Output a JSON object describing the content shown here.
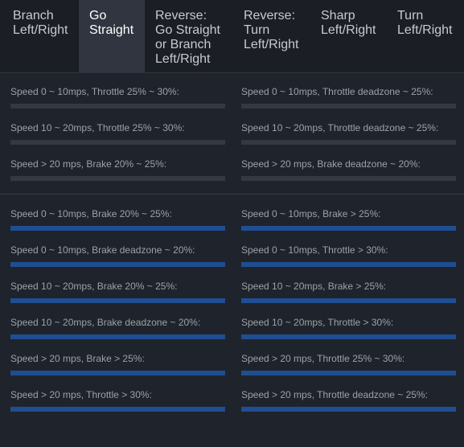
{
  "tabs": [
    {
      "lines": [
        "Branch",
        "Left/Right"
      ],
      "active": false
    },
    {
      "lines": [
        "Go",
        "Straight"
      ],
      "active": true
    },
    {
      "lines": [
        "Reverse:",
        "Go Straight",
        "or Branch",
        "Left/Right"
      ],
      "active": false
    },
    {
      "lines": [
        "Reverse:",
        "Turn",
        "Left/Right"
      ],
      "active": false
    },
    {
      "lines": [
        "Sharp",
        "Left/Right"
      ],
      "active": false
    },
    {
      "lines": [
        "Turn",
        "Left/Right"
      ],
      "active": false
    }
  ],
  "colors": {
    "background": "#1f232b",
    "bar_track": "#34383f",
    "bar_fill": "#1f4e93",
    "active_tab": "#30353f"
  },
  "section1": {
    "left": [
      {
        "label": "Speed 0 ~ 10mps, Throttle 25% ~ 30%:",
        "level": 0
      },
      {
        "label": "Speed 10 ~ 20mps, Throttle 25% ~ 30%:",
        "level": 0
      },
      {
        "label": "Speed > 20 mps, Brake 20% ~ 25%:",
        "level": 0
      }
    ],
    "right": [
      {
        "label": "Speed 0 ~ 10mps, Throttle deadzone ~ 25%:",
        "level": 0
      },
      {
        "label": "Speed 10 ~ 20mps, Throttle deadzone ~ 25%:",
        "level": 0
      },
      {
        "label": "Speed > 20 mps, Brake deadzone ~ 20%:",
        "level": 0
      }
    ]
  },
  "section2": {
    "left": [
      {
        "label": "Speed 0 ~ 10mps, Brake 20% ~ 25%:",
        "level": 1
      },
      {
        "label": "Speed 0 ~ 10mps, Brake deadzone ~ 20%:",
        "level": 1
      },
      {
        "label": "Speed 10 ~ 20mps, Brake 20% ~ 25%:",
        "level": 1
      },
      {
        "label": "Speed 10 ~ 20mps, Brake deadzone ~ 20%:",
        "level": 1
      },
      {
        "label": "Speed > 20 mps, Brake > 25%:",
        "level": 1
      },
      {
        "label": "Speed > 20 mps, Throttle > 30%:",
        "level": 1
      }
    ],
    "right": [
      {
        "label": "Speed 0 ~ 10mps, Brake > 25%:",
        "level": 1
      },
      {
        "label": "Speed 0 ~ 10mps, Throttle > 30%:",
        "level": 1
      },
      {
        "label": "Speed 10 ~ 20mps, Brake > 25%:",
        "level": 1
      },
      {
        "label": "Speed 10 ~ 20mps, Throttle > 30%:",
        "level": 1
      },
      {
        "label": "Speed > 20 mps, Throttle 25% ~ 30%:",
        "level": 1
      },
      {
        "label": "Speed > 20 mps, Throttle deadzone ~ 25%:",
        "level": 1
      }
    ]
  }
}
